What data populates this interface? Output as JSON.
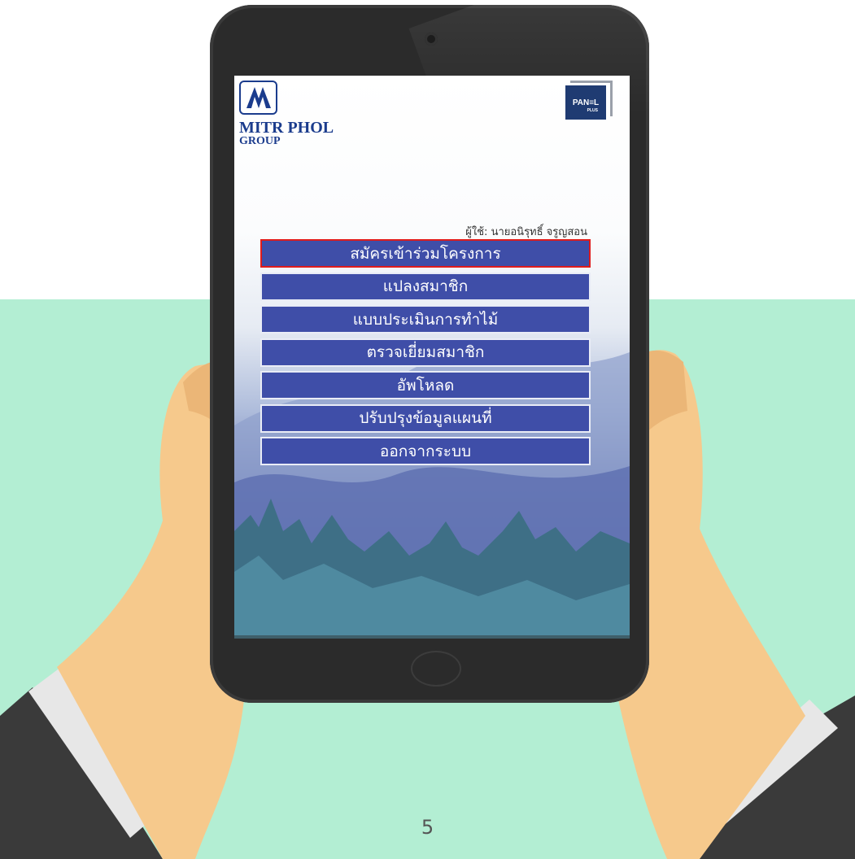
{
  "logo": {
    "company_line1": "MITR PHOL",
    "company_line2": "GROUP",
    "partner_name": "PAN≡L",
    "partner_sub": "PLUS"
  },
  "user_label": "ผู้ใช้: นายอนิรุทธิ์ จรูญสอน",
  "menu": [
    {
      "label": "สมัครเข้าร่วมโครงการ",
      "selected": true
    },
    {
      "label": "แปลงสมาชิก",
      "selected": false
    },
    {
      "label": "แบบประเมินการทำไม้",
      "selected": false
    },
    {
      "label": "ตรวจเยี่ยมสมาชิก",
      "selected": false
    },
    {
      "label": "อัพโหลด",
      "selected": false
    },
    {
      "label": "ปรับปรุงข้อมูลแผนที่",
      "selected": false
    },
    {
      "label": "ออกจากระบบ",
      "selected": false
    }
  ],
  "page_number": "5",
  "colors": {
    "background_band": "#b3eed3",
    "menu_button": "#3f4ea8",
    "selected_border": "#e01b1b",
    "brand_blue": "#1b3c8d"
  }
}
